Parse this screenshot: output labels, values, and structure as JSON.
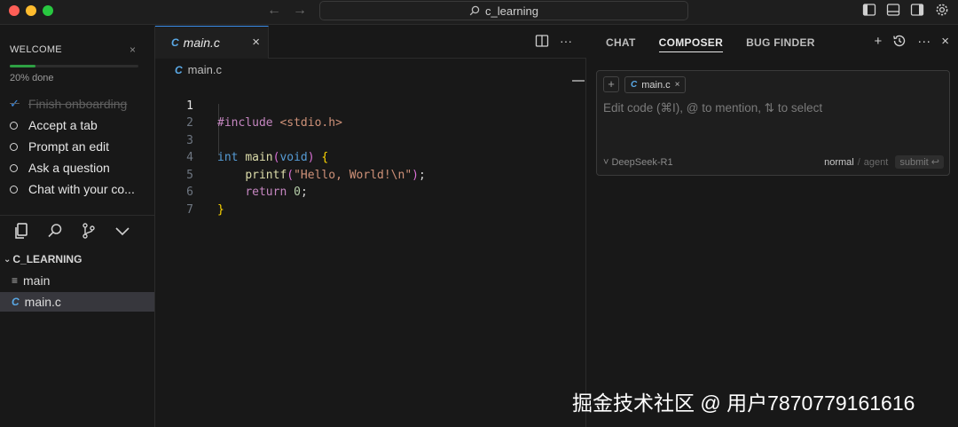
{
  "titlebar": {
    "search_text": "c_learning",
    "back_icon": "←",
    "forward_icon": "→"
  },
  "welcome": {
    "title": "WELCOME",
    "close": "×",
    "progress_fraction": 0.2,
    "progress_text": "20% done",
    "items": [
      {
        "label": "Finish onboarding",
        "done": true
      },
      {
        "label": "Accept a tab",
        "done": false
      },
      {
        "label": "Prompt an edit",
        "done": false
      },
      {
        "label": "Ask a question",
        "done": false
      },
      {
        "label": "Chat with your co...",
        "done": false
      }
    ]
  },
  "explorer": {
    "folder": "C_LEARNING",
    "files": [
      {
        "name": "main",
        "icon": "≡"
      },
      {
        "name": "main.c",
        "icon": "C",
        "active": true
      }
    ]
  },
  "editor": {
    "tab_name": "main.c",
    "tab_close": "×",
    "breadcrumb": "main.c",
    "c_icon": "C",
    "actions_more": "···",
    "line_numbers": [
      "1",
      "2",
      "3",
      "4",
      "5",
      "6",
      "7"
    ]
  },
  "right_panel": {
    "tabs": [
      "CHAT",
      "COMPOSER",
      "BUG FINDER"
    ],
    "active_tab": "COMPOSER",
    "add": "+",
    "more": "···",
    "close": "×",
    "composer": {
      "plus": "+",
      "chip_icon": "C",
      "chip_label": "main.c",
      "chip_close": "×",
      "placeholder": "Edit code (⌘I), @ to mention, ⇅ to select",
      "model": "˅ DeepSeek-R1",
      "mode_normal": "normal",
      "mode_sep": "/",
      "mode_agent": "agent",
      "submit": "submit ↩"
    }
  },
  "watermark": "掘金技术社区 @ 用户7870779161616",
  "colors": {
    "accent": "#3b8eea",
    "progress": "#2ea043"
  }
}
